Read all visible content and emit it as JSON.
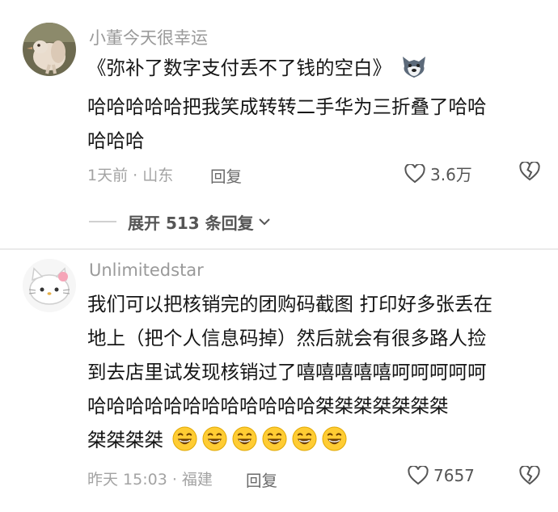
{
  "comments": [
    {
      "username": "小董今天很幸运",
      "text_lines": [
        "《弥补了数字支付丢不了钱的空白》",
        "哈哈哈哈哈把我笑成转转二手华为三折叠了哈哈",
        "哈哈哈"
      ],
      "time_location": "1天前 · 山东",
      "reply_label": "回复",
      "like_count": "3.6万",
      "avatar_icon": "bird-avatar-icon",
      "inline_icon": "wolf-emoji-icon"
    },
    {
      "username": "Unlimitedstar",
      "text_lines": [
        "我们可以把核销完的团购码截图 打印好多张丢在",
        "地上（把个人信息码掉）然后就会有很多路人捡",
        "到去店里试发现核销过了嘻嘻嘻嘻嘻呵呵呵呵呵",
        "哈哈哈哈哈哈哈哈哈哈哈哈桀桀桀桀桀桀桀",
        "桀桀桀桀"
      ],
      "time_location": "昨天 15:03 · 福建",
      "reply_label": "回复",
      "like_count": "7657",
      "avatar_icon": "hello-kitty-avatar-icon",
      "emoji_count": 6,
      "inline_icon": "grinning-face-emoji-icon"
    }
  ],
  "expand_replies_label": "展开 513 条回复",
  "colors": {
    "meta": "#a3a3a3",
    "username": "#9a9a9a",
    "text": "#161616"
  }
}
